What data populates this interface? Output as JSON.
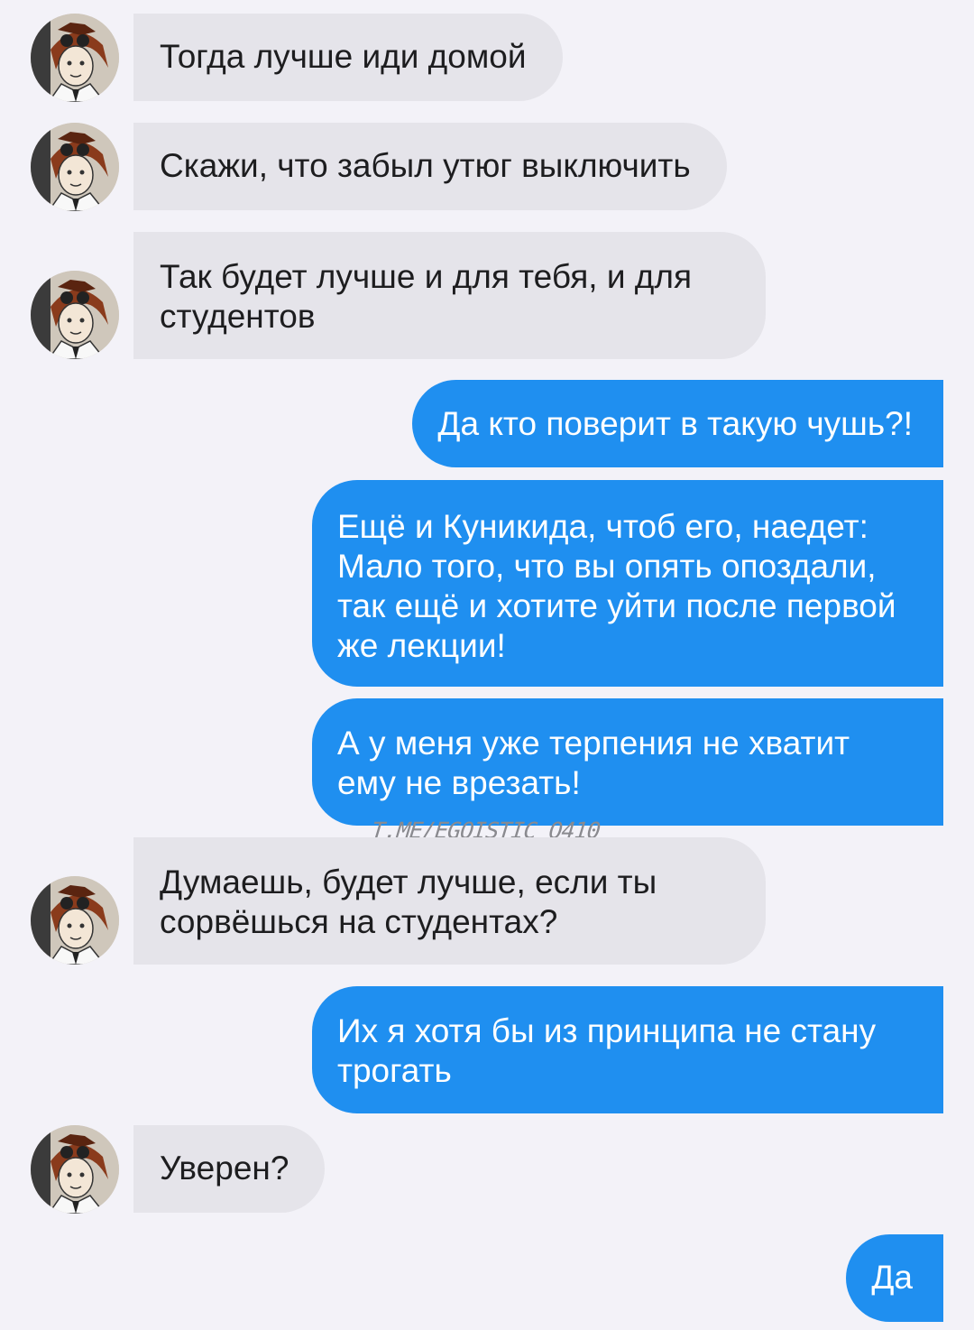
{
  "messages": [
    {
      "side": "in",
      "text": "Тогда лучше иди домой"
    },
    {
      "side": "in",
      "text": "Скажи, что забыл утюг выключить"
    },
    {
      "side": "in",
      "text": "Так будет лучше и для тебя, и для студентов"
    },
    {
      "side": "out",
      "text": "Да кто поверит в такую чушь?!"
    },
    {
      "side": "out",
      "text": "Ещё и Куникида, чтоб его, наедет: Мало того, что вы опять опоздали, так ещё и хотите уйти после первой же лекции!"
    },
    {
      "side": "out",
      "text": "А у меня уже терпения не хватит ему не врезать!"
    },
    {
      "side": "in",
      "text": "Думаешь, будет лучше, если ты сорвёшься на студентах?"
    },
    {
      "side": "out",
      "text": "Их я хотя бы из принципа не стану трогать"
    },
    {
      "side": "in",
      "text": "Уверен?"
    },
    {
      "side": "out",
      "text": "Да"
    }
  ],
  "watermark": "T.ME/EGOISTIC_O410",
  "avatar_icon": "anime-character-avatar-icon",
  "colors": {
    "background": "#f3f2f8",
    "incoming_bubble": "#e5e4ea",
    "outgoing_bubble": "#1f8ff0",
    "incoming_text": "#1d1d1f",
    "outgoing_text": "#ffffff"
  }
}
